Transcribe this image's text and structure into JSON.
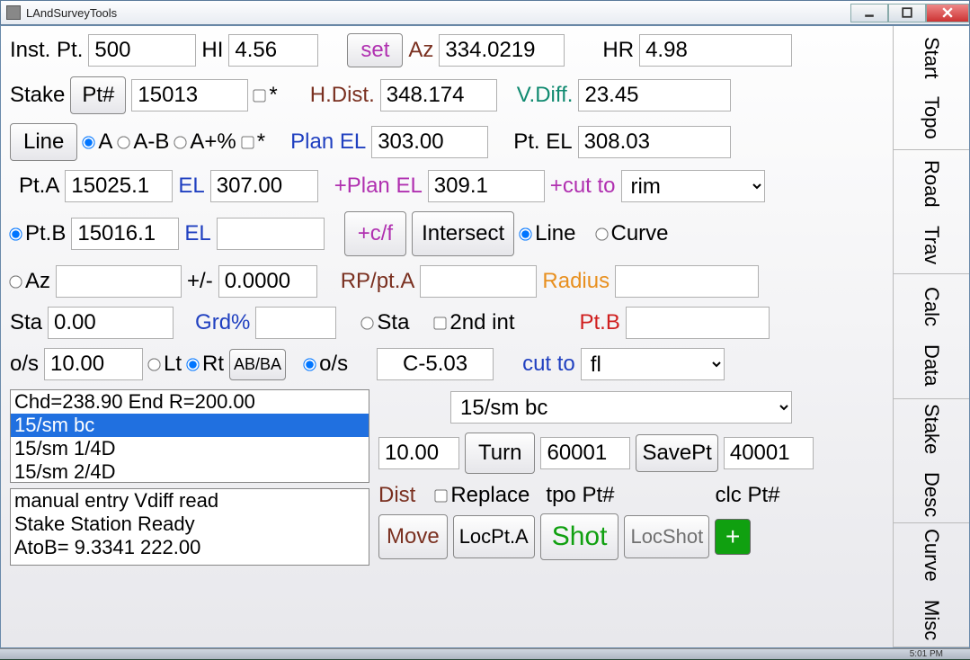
{
  "window": {
    "title": "LAndSurveyTools"
  },
  "r1": {
    "inst_pt_lbl": "Inst. Pt.",
    "inst_pt": "500",
    "hi_lbl": "HI",
    "hi": "4.56",
    "set_btn": "set",
    "az_lbl": "Az",
    "az": "334.0219",
    "hr_lbl": "HR",
    "hr": "4.98"
  },
  "r2": {
    "stake_lbl": "Stake",
    "pt_btn": "Pt#",
    "pt": "15013",
    "star": "*",
    "hdist_lbl": "H.Dist.",
    "hdist": "348.174",
    "vdiff_lbl": "V.Diff.",
    "vdiff": "23.45"
  },
  "r3": {
    "line_btn": "Line",
    "a": "A",
    "ab": "A-B",
    "apct": "A+%",
    "star": "*",
    "plan_el_lbl": "Plan EL",
    "plan_el": "303.00",
    "pt_el_lbl": "Pt. EL",
    "pt_el": "308.03"
  },
  "r4": {
    "pta_lbl": "Pt.A",
    "pta": "15025.1",
    "el_lbl": "EL",
    "el": "307.00",
    "pplan_lbl": "+Plan EL",
    "pplan": "309.1",
    "cut_lbl": "+cut to",
    "cut": "rim"
  },
  "r5": {
    "ptb_lbl": "Pt.B",
    "ptb": "15016.1",
    "el_lbl": "EL",
    "el": "",
    "cf_btn": "+c/f",
    "int_btn": "Intersect",
    "line": "Line",
    "curve": "Curve"
  },
  "r6": {
    "az_lbl": "Az",
    "az": "",
    "pm_lbl": "+/-",
    "pm": "0.0000",
    "rp_lbl": "RP/pt.A",
    "rp": "",
    "radius_lbl": "Radius",
    "radius": ""
  },
  "r7": {
    "sta_lbl": "Sta",
    "sta": "0.00",
    "grd_lbl": "Grd%",
    "grd": "",
    "sta2_lbl": "Sta",
    "int2_lbl": "2nd int",
    "ptb_lbl": "Pt.B",
    "ptb": ""
  },
  "r8": {
    "os_lbl": "o/s",
    "os": "10.00",
    "lt": "Lt",
    "rt": "Rt",
    "abba": "AB/BA",
    "os2_lbl": "o/s",
    "os2": "C-5.03",
    "cut_lbl": "cut to",
    "cut": "fl"
  },
  "list1": {
    "items": [
      "Chd=238.90 End R=200.00",
      "15/sm bc",
      "15/sm 1/4D",
      "15/sm 2/4D"
    ],
    "selected": 1
  },
  "combo": {
    "value": "15/sm bc"
  },
  "r10": {
    "v1": "10.00",
    "turn": "Turn",
    "v2": "60001",
    "save": "SavePt",
    "v3": "40001"
  },
  "r11": {
    "dist": "Dist",
    "replace": "Replace",
    "tpo": "tpo Pt#",
    "clc": "clc Pt#"
  },
  "list2": {
    "items": [
      "manual entry Vdiff read",
      "Stake Station Ready",
      "AtoB= 9.3341  222.00"
    ]
  },
  "r12": {
    "move": "Move",
    "locpta": "LocPt.A",
    "shot": "Shot",
    "locshot": "LocShot"
  },
  "side": {
    "b1a": "Start",
    "b1b": "Topo",
    "b2a": "Road",
    "b2b": "Trav",
    "b3a": "Calc",
    "b3b": "Data",
    "b4a": "Stake",
    "b4b": "Desc",
    "b5a": "Curve",
    "b5b": "Misc"
  },
  "status_time": "5:01 PM"
}
